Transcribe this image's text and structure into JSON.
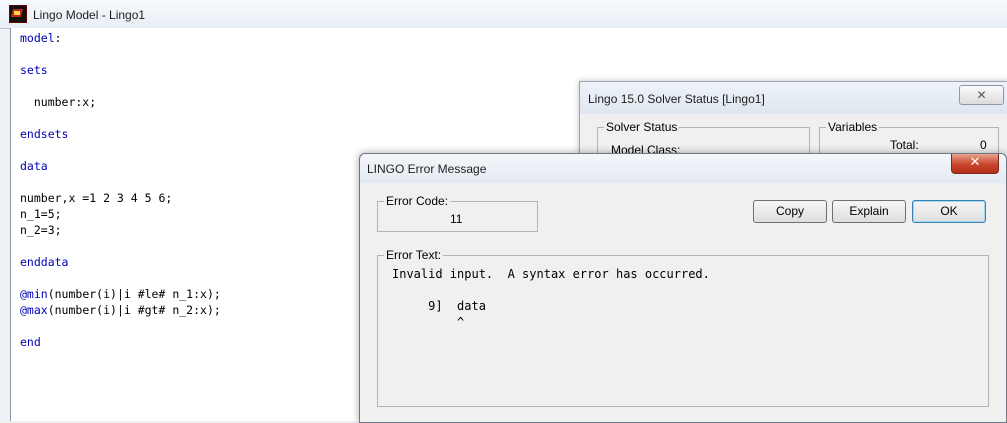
{
  "main_window": {
    "title": "Lingo Model - Lingo1",
    "code_lines": [
      {
        "parts": [
          {
            "t": "model",
            "kw": true
          },
          {
            "t": ":",
            "kw": false
          }
        ]
      },
      {
        "parts": []
      },
      {
        "parts": [
          {
            "t": "sets",
            "kw": true
          }
        ]
      },
      {
        "parts": []
      },
      {
        "parts": [
          {
            "t": "  number:x;",
            "kw": false
          }
        ]
      },
      {
        "parts": []
      },
      {
        "parts": [
          {
            "t": "endsets",
            "kw": true
          }
        ]
      },
      {
        "parts": []
      },
      {
        "parts": [
          {
            "t": "data",
            "kw": true
          }
        ]
      },
      {
        "parts": []
      },
      {
        "parts": [
          {
            "t": "number,x =1 2 3 4 5 6;",
            "kw": false
          }
        ]
      },
      {
        "parts": [
          {
            "t": "n_1=5;",
            "kw": false
          }
        ]
      },
      {
        "parts": [
          {
            "t": "n_2=3;",
            "kw": false
          }
        ]
      },
      {
        "parts": []
      },
      {
        "parts": [
          {
            "t": "enddata",
            "kw": true
          }
        ]
      },
      {
        "parts": []
      },
      {
        "parts": [
          {
            "t": "@min",
            "kw": true
          },
          {
            "t": "(number(i)|i #le# n_1:x);",
            "kw": false
          }
        ]
      },
      {
        "parts": [
          {
            "t": "@max",
            "kw": true
          },
          {
            "t": "(number(i)|i #gt# n_2:x);",
            "kw": false
          }
        ]
      },
      {
        "parts": []
      },
      {
        "parts": [
          {
            "t": "end",
            "kw": true
          }
        ]
      }
    ]
  },
  "solver_window": {
    "title": "Lingo 15.0 Solver Status [Lingo1]",
    "close_label": "✕",
    "solver_status_group": "Solver Status",
    "model_class_label": "Model Class:",
    "variables_group": "Variables",
    "total_label": "Total:",
    "total_value": "0"
  },
  "error_dialog": {
    "title": "LINGO Error Message",
    "close_label": "✕",
    "error_code_group": "Error Code:",
    "error_code_value": "11",
    "copy_label": "Copy",
    "explain_label": "Explain",
    "ok_label": "OK",
    "error_text_group": "Error Text:",
    "error_text": "Invalid input.  A syntax error has occurred.\n\n     9]  data\n         ^"
  }
}
